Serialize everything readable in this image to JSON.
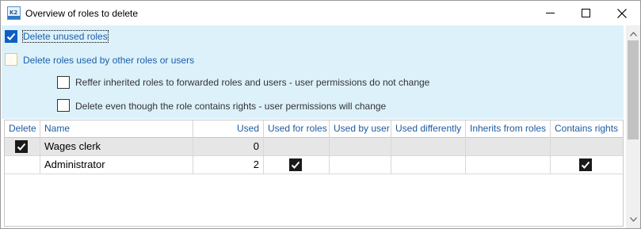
{
  "window": {
    "title": "Overview of roles to delete",
    "app_icon": "k2-app-icon",
    "app_icon_text": "K2",
    "controls": [
      "minimize-icon",
      "maximize-icon",
      "close-icon"
    ]
  },
  "options": {
    "delete_unused": {
      "label": "Delete unused roles",
      "checked": true
    },
    "delete_used": {
      "label": "Delete roles used by other roles or users",
      "checked": false
    },
    "refer_inherited": {
      "label": "Reffer inherited roles to forwarded roles and users - user permissions do not change",
      "checked": false
    },
    "delete_with_rights": {
      "label": "Delete even though the role contains rights - user permissions will change",
      "checked": false
    }
  },
  "grid": {
    "columns": [
      "Delete",
      "Name",
      "Used",
      "Used for roles",
      "Used by user",
      "Used differently",
      "Inherits from roles",
      "Contains rights"
    ],
    "rows": [
      {
        "delete": true,
        "name": "Wages clerk",
        "used": "0",
        "used_for_roles": false,
        "used_by_user": false,
        "used_differently": false,
        "inherits_from_roles": false,
        "contains_rights": false
      },
      {
        "delete": false,
        "name": "Administrator",
        "used": "2",
        "used_for_roles": true,
        "used_by_user": false,
        "used_differently": false,
        "inherits_from_roles": false,
        "contains_rights": true
      }
    ]
  },
  "colors": {
    "options_background": "#ddf1fb",
    "header_text": "#1e5aa0",
    "checkbox_blue": "#0e5ec2",
    "selected_row": "#e6e6e6"
  }
}
